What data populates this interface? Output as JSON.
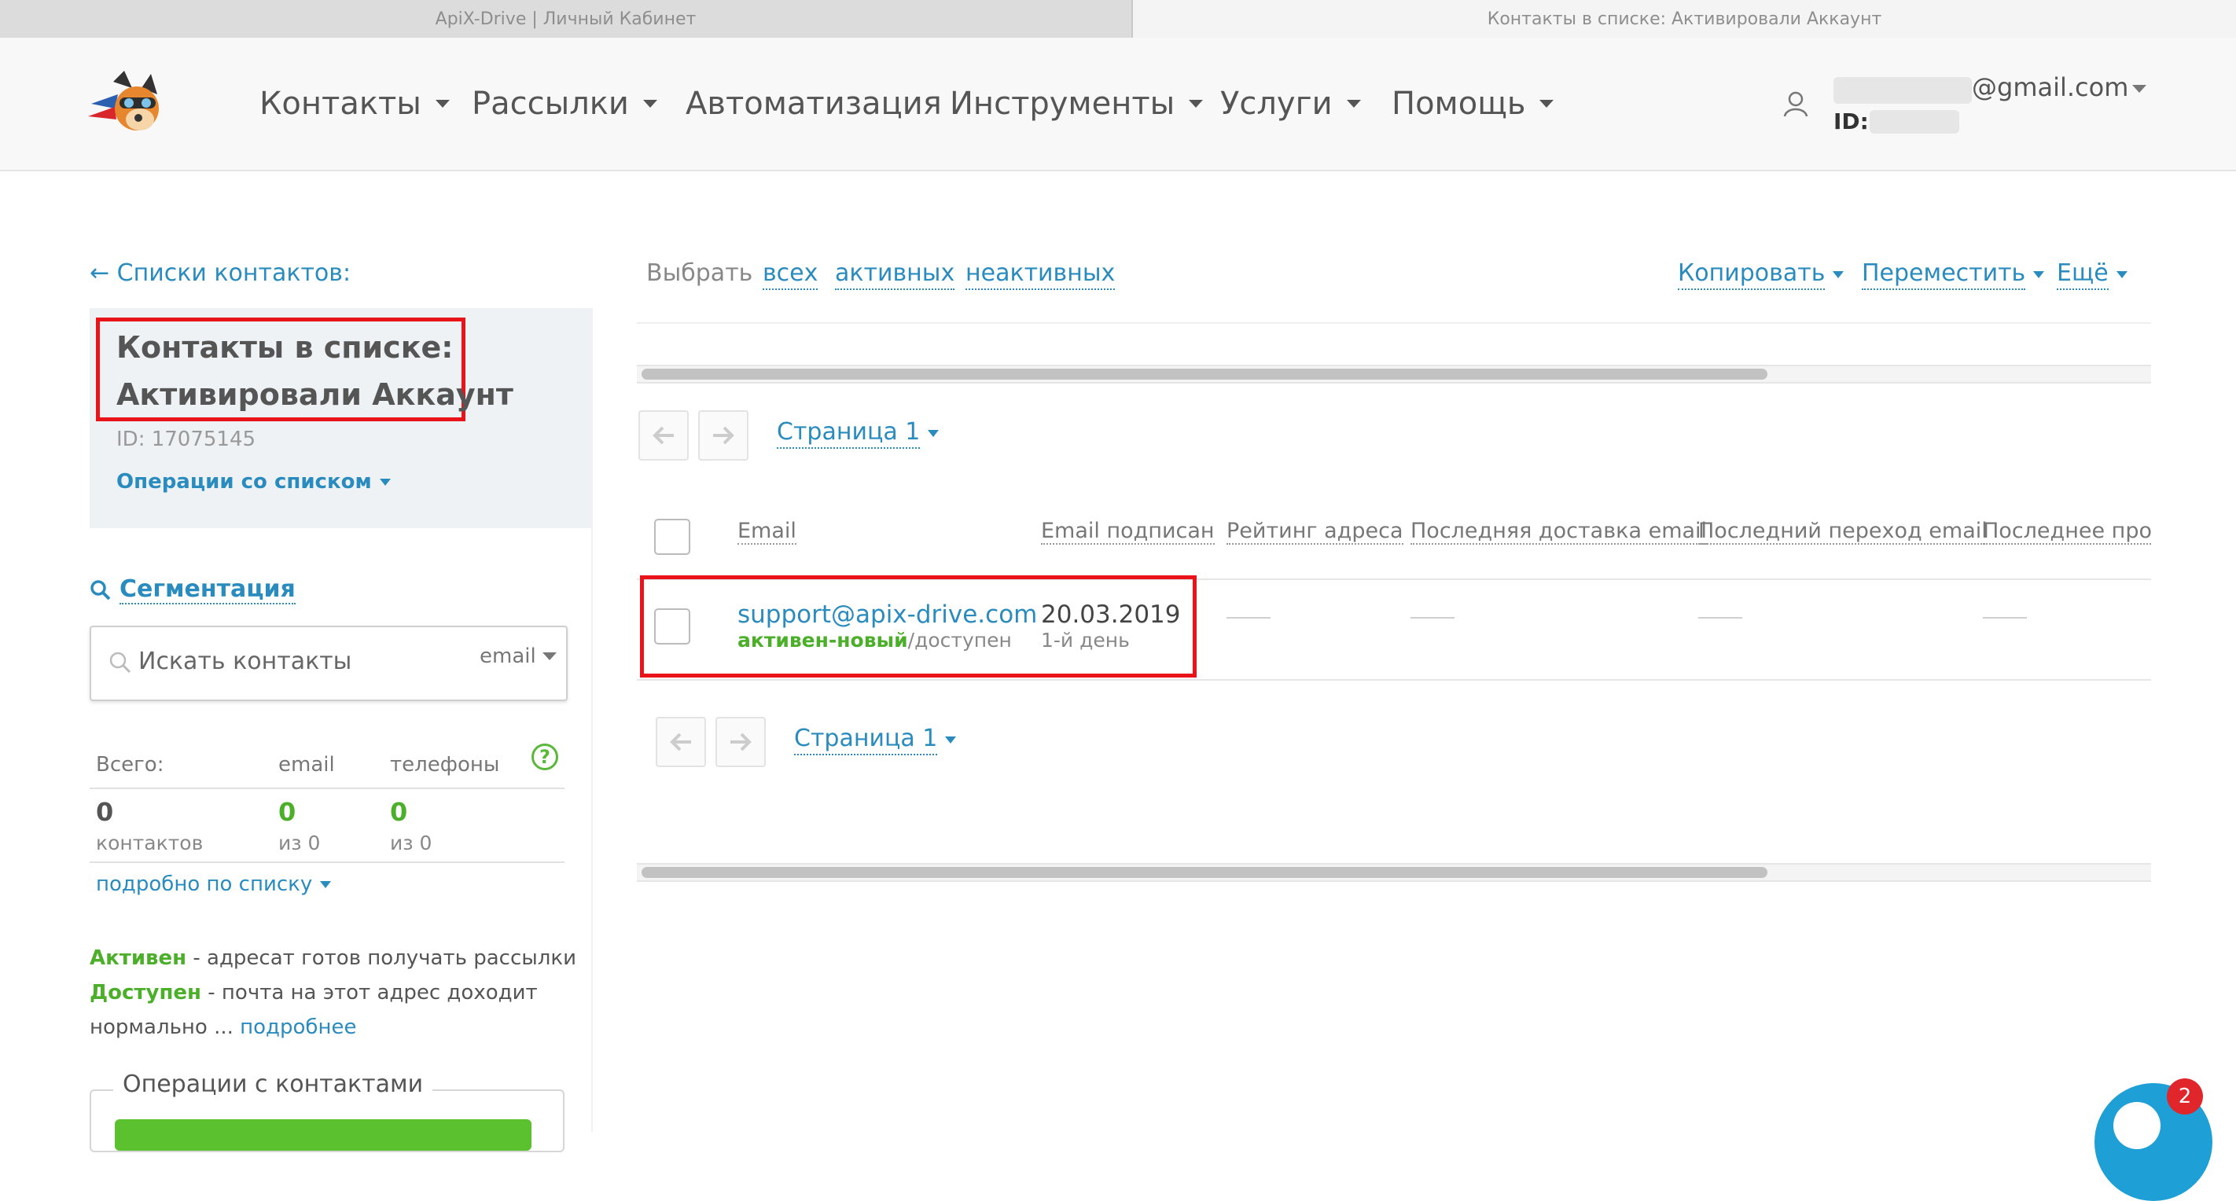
{
  "browser_tabs": [
    "ApiX-Drive | Личный Кабинет",
    "Контакты в списке: Активировали Аккаунт"
  ],
  "nav": {
    "items": [
      "Контакты",
      "Рассылки",
      "Автоматизация",
      "Инструменты",
      "Услуги",
      "Помощь"
    ],
    "account_email_suffix": "@gmail.com",
    "account_id_label": "ID:"
  },
  "sidebar": {
    "back_link": "← Списки контактов:",
    "list_title_line1": "Контакты в списке:",
    "list_title_line2": "Активировали Аккаунт",
    "list_id": "ID: 17075145",
    "list_ops": "Операции со списком",
    "segmentation": "Сегментация",
    "search_placeholder": "Искать контакты",
    "search_type": "email",
    "stats": {
      "total_label": "Всего:",
      "email_label": "email",
      "phones_label": "телефоны",
      "total_value": "0",
      "total_unit": "контактов",
      "email_value": "0",
      "email_of": "из 0",
      "phones_value": "0",
      "phones_of": "из 0"
    },
    "details_link": "подробно по списку",
    "legend_active_word": "Активен",
    "legend_active_text": " - адресат готов получать рассылки",
    "legend_available_word": "Доступен",
    "legend_available_text": " - почта на этот адрес доходит",
    "legend_more_prefix": "нормально ... ",
    "legend_more_link": "подробнее",
    "contacts_ops_title": "Операции с контактами",
    "chat_badge": "2"
  },
  "main": {
    "select_label": "Выбрать",
    "select_all": "всех",
    "select_active": "активных",
    "select_inactive": "неактивных",
    "copy": "Копировать",
    "move": "Переместить",
    "more": "Ещё",
    "page_label": "Страница 1",
    "columns": [
      "Email",
      "Email подписан",
      "Рейтинг адреса",
      "Последняя доставка email",
      "Последний переход email",
      "Последнее прочте"
    ],
    "row": {
      "email": "support@apix-drive.com",
      "status_active": "активен-новый",
      "status_rest": "/доступен",
      "date": "20.03.2019",
      "day": "1-й день"
    }
  }
}
